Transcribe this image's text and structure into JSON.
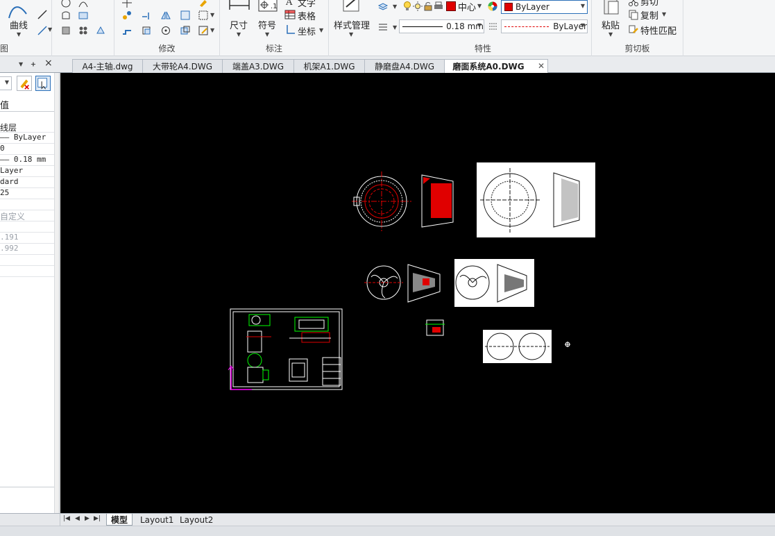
{
  "ribbon": {
    "draw_group": {
      "curve_label": "曲线",
      "group_label": "图"
    },
    "modify_group": {
      "group_label": "修改"
    },
    "annotate_group": {
      "dimension_label": "尺寸",
      "symbol_label": "符号",
      "text_label": "文字",
      "table_label": "表格",
      "coord_label": "坐标",
      "group_label": "标注"
    },
    "style_group": {
      "style_label": "样式管理"
    },
    "properties_group": {
      "layer_name": "中心",
      "color_value": "ByLayer",
      "lineweight_value": "0.18 mm",
      "linetype_value": "ByLayer",
      "group_label": "特性"
    },
    "clipboard_group": {
      "paste_label": "粘贴",
      "cut_label": "剪切",
      "copy_label": "复制",
      "match_label": "特性匹配",
      "group_label": "剪切板"
    }
  },
  "tabs": [
    {
      "label": "A4-主轴.dwg"
    },
    {
      "label": "大带轮A4.DWG"
    },
    {
      "label": "端盖A3.DWG"
    },
    {
      "label": "机架A1.DWG"
    },
    {
      "label": "静磨盘A4.DWG"
    },
    {
      "label": "磨面系统A0.DWG",
      "active": true
    }
  ],
  "properties_panel": {
    "pin_glyph": "ᚐ",
    "close_glyph": "×",
    "header": "值",
    "rows": [
      {
        "text": "线层",
        "dim": false
      },
      {
        "text": "—— ByLayer",
        "dim": false
      },
      {
        "text": "0",
        "dim": false
      },
      {
        "text": "—— 0.18 mm",
        "dim": false
      },
      {
        "text": "Layer",
        "dim": false
      },
      {
        "text": "dard",
        "dim": false
      },
      {
        "text": "25",
        "dim": false
      },
      {
        "text": "",
        "dim": false
      },
      {
        "text": "自定义",
        "dim": true
      },
      {
        "text": "",
        "dim": false
      },
      {
        "text": ".191",
        "dim": true
      },
      {
        "text": ".992",
        "dim": true
      },
      {
        "text": "",
        "dim": false
      },
      {
        "text": "",
        "dim": false
      }
    ]
  },
  "layout_tabs": [
    {
      "label": "模型",
      "active": true
    },
    {
      "label": "Layout1"
    },
    {
      "label": "Layout2"
    }
  ],
  "colors": {
    "canvas": "#000000",
    "red": "#e00000",
    "green": "#00ff00",
    "magenta": "#ff00ff"
  }
}
